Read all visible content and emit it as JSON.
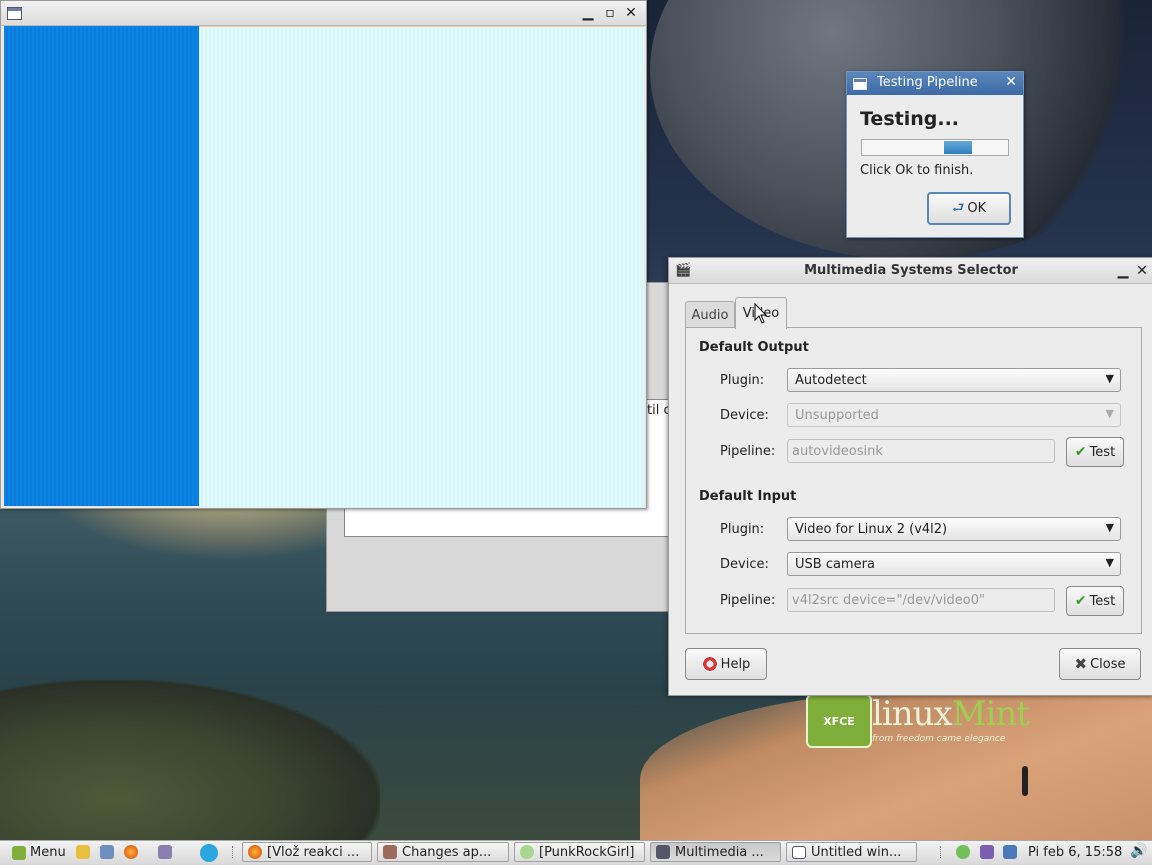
{
  "desktop": {
    "logo_box_text": "XFCE",
    "logo_word1": "linux",
    "logo_word2": "Mint",
    "logo_tagline": "from freedom came elegance"
  },
  "background_window": {
    "text_fragment": "til c"
  },
  "empty_window": {
    "title": ""
  },
  "testing_dialog": {
    "title": "Testing Pipeline",
    "heading": "Testing...",
    "progress_fill_start": 0.56,
    "progress_fill_width": 0.19,
    "message": "Click Ok to finish.",
    "ok_label": "OK"
  },
  "multimedia_window": {
    "title": "Multimedia Systems Selector",
    "tabs": [
      {
        "label": "Audio",
        "active": false
      },
      {
        "label": "Video",
        "active": true
      }
    ],
    "default_output": {
      "heading": "Default Output",
      "plugin_label": "Plugin:",
      "plugin_value": "Autodetect",
      "device_label": "Device:",
      "device_value": "Unsupported",
      "pipeline_label": "Pipeline:",
      "pipeline_value": "autovideosink",
      "test_label": "Test"
    },
    "default_input": {
      "heading": "Default Input",
      "plugin_label": "Plugin:",
      "plugin_value": "Video for Linux 2 (v4l2)",
      "device_label": "Device:",
      "device_value": "USB camera",
      "pipeline_label": "Pipeline:",
      "pipeline_value": "v4l2src device=\"/dev/video0\"",
      "test_label": "Test"
    },
    "help_label": "Help",
    "close_label": "Close"
  },
  "taskbar": {
    "menu_label": "Menu",
    "tasks": [
      {
        "label": "[Vlož reakci ...",
        "icon": "firefox-icon",
        "active": false
      },
      {
        "label": "Changes ap...",
        "icon": "settings-icon",
        "active": false
      },
      {
        "label": "[PunkRockGirl]",
        "icon": "pidgin-icon",
        "active": false
      },
      {
        "label": "Multimedia ...",
        "icon": "multimedia-icon",
        "active": true
      },
      {
        "label": "Untitled win...",
        "icon": "window-icon",
        "active": false
      }
    ],
    "clock": "Pi feb  6, 15:58"
  }
}
